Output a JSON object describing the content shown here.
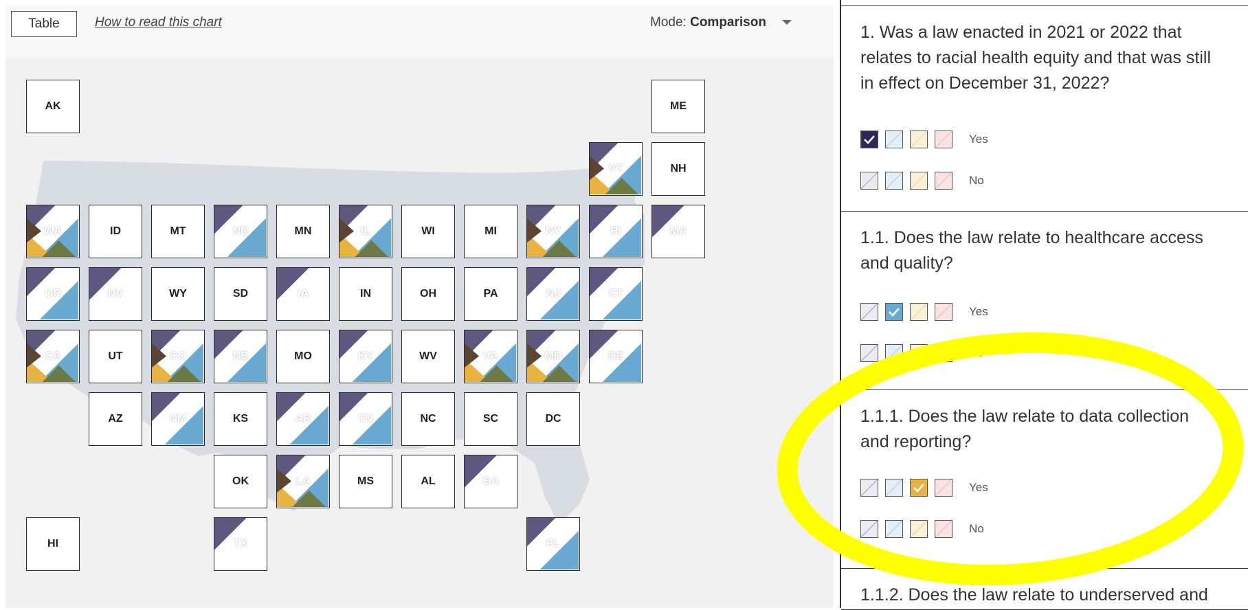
{
  "toolbar": {
    "table_label": "Table",
    "howto_label": "How to read this chart",
    "mode_prefix": "Mode:",
    "mode_value": "Comparison"
  },
  "colors": {
    "purple": "#5e5880",
    "blue": "#6aa9d2",
    "orange": "#e9b341",
    "olive": "#6d7a43",
    "brown": "#5a4630",
    "checkbox_checked_purple": "#2d2a5a",
    "highlight": "#ffff00"
  },
  "legend_note": "tile stripes: purple=law enacted, blue=healthcare access, orange=data collection, olive/brown=other categories",
  "states": [
    {
      "abbr": "AK",
      "fill": "none"
    },
    {
      "abbr": "ME",
      "fill": "none"
    },
    {
      "abbr": "VT",
      "fill": "full"
    },
    {
      "abbr": "NH",
      "fill": "none"
    },
    {
      "abbr": "WA",
      "fill": "full"
    },
    {
      "abbr": "ID",
      "fill": "none"
    },
    {
      "abbr": "MT",
      "fill": "none"
    },
    {
      "abbr": "ND",
      "fill": "purple-blue"
    },
    {
      "abbr": "MN",
      "fill": "none"
    },
    {
      "abbr": "IL",
      "fill": "full"
    },
    {
      "abbr": "WI",
      "fill": "none"
    },
    {
      "abbr": "MI",
      "fill": "none"
    },
    {
      "abbr": "NY",
      "fill": "full"
    },
    {
      "abbr": "RI",
      "fill": "purple-blue"
    },
    {
      "abbr": "MA",
      "fill": "purple"
    },
    {
      "abbr": "OR",
      "fill": "purple-blue"
    },
    {
      "abbr": "NV",
      "fill": "purple"
    },
    {
      "abbr": "WY",
      "fill": "none"
    },
    {
      "abbr": "SD",
      "fill": "none"
    },
    {
      "abbr": "IA",
      "fill": "purple"
    },
    {
      "abbr": "IN",
      "fill": "none"
    },
    {
      "abbr": "OH",
      "fill": "none"
    },
    {
      "abbr": "PA",
      "fill": "none"
    },
    {
      "abbr": "NJ",
      "fill": "purple-blue"
    },
    {
      "abbr": "CT",
      "fill": "purple-blue"
    },
    {
      "abbr": "CA",
      "fill": "full"
    },
    {
      "abbr": "UT",
      "fill": "none"
    },
    {
      "abbr": "CO",
      "fill": "full"
    },
    {
      "abbr": "NE",
      "fill": "purple-blue"
    },
    {
      "abbr": "MO",
      "fill": "none"
    },
    {
      "abbr": "KY",
      "fill": "purple-blue"
    },
    {
      "abbr": "WV",
      "fill": "none"
    },
    {
      "abbr": "VA",
      "fill": "full"
    },
    {
      "abbr": "MD",
      "fill": "full"
    },
    {
      "abbr": "DE",
      "fill": "purple-blue"
    },
    {
      "abbr": "AZ",
      "fill": "none"
    },
    {
      "abbr": "NM",
      "fill": "purple-blue"
    },
    {
      "abbr": "KS",
      "fill": "none"
    },
    {
      "abbr": "AR",
      "fill": "purple-blue"
    },
    {
      "abbr": "TN",
      "fill": "purple-blue"
    },
    {
      "abbr": "NC",
      "fill": "none"
    },
    {
      "abbr": "SC",
      "fill": "none"
    },
    {
      "abbr": "DC",
      "fill": "none"
    },
    {
      "abbr": "OK",
      "fill": "none"
    },
    {
      "abbr": "LA",
      "fill": "full"
    },
    {
      "abbr": "MS",
      "fill": "none"
    },
    {
      "abbr": "AL",
      "fill": "none"
    },
    {
      "abbr": "GA",
      "fill": "purple"
    },
    {
      "abbr": "HI",
      "fill": "none"
    },
    {
      "abbr": "TX",
      "fill": "purple"
    },
    {
      "abbr": "FL",
      "fill": "purple-blue"
    }
  ],
  "questions": [
    {
      "text": "1. Was a law enacted in 2021 or 2022 that relates to racial health equity and that was still in effect on December 31, 2022?",
      "options": [
        {
          "label": "Yes",
          "checked_index": 0
        },
        {
          "label": "No",
          "checked_index": -1
        }
      ]
    },
    {
      "text": "1.1. Does the law relate to healthcare access and quality?",
      "options": [
        {
          "label": "Yes",
          "checked_index": 1
        },
        {
          "label": "No",
          "checked_index": -1
        }
      ]
    },
    {
      "text": "1.1.1. Does the law relate to data collection and reporting?",
      "options": [
        {
          "label": "Yes",
          "checked_index": 2
        },
        {
          "label": "No",
          "checked_index": -1
        }
      ]
    },
    {
      "text": "1.1.2. Does the law relate to underserved and",
      "options": []
    }
  ]
}
